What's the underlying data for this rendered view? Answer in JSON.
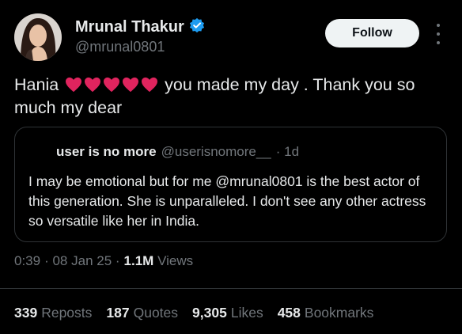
{
  "author": {
    "name": "Mrunal Thakur",
    "handle": "@mrunal0801",
    "verified_icon": "verified-badge-icon",
    "verified_color": "#1d9bf0"
  },
  "follow_button": {
    "label": "Follow"
  },
  "more_icon": "more-options-icon",
  "tweet": {
    "text_before": "Hania",
    "hearts_count": 5,
    "heart_color": "#e0245e",
    "text_after": " you made my day . Thank you so much my dear"
  },
  "quoted": {
    "name": "user is no more",
    "handle": "@userisnomore__",
    "time": "· 1d",
    "text": "I may be emotional but for me @mrunal0801 is the best actor of this generation. She is unparalleled. I don't see any other actress so versatile like her in India."
  },
  "meta": {
    "time": "0:39",
    "date": "· 08 Jan 25 ·",
    "views_value": "1.1M",
    "views_label": "Views"
  },
  "stats": {
    "reposts": {
      "value": "339",
      "label": "Reposts"
    },
    "quotes": {
      "value": "187",
      "label": "Quotes"
    },
    "likes": {
      "value": "9,305",
      "label": "Likes"
    },
    "bookmarks": {
      "value": "458",
      "label": "Bookmarks"
    }
  },
  "colors": {
    "background": "#000000",
    "text": "#e7e9ea",
    "muted": "#71767b",
    "border": "#2f3336"
  }
}
